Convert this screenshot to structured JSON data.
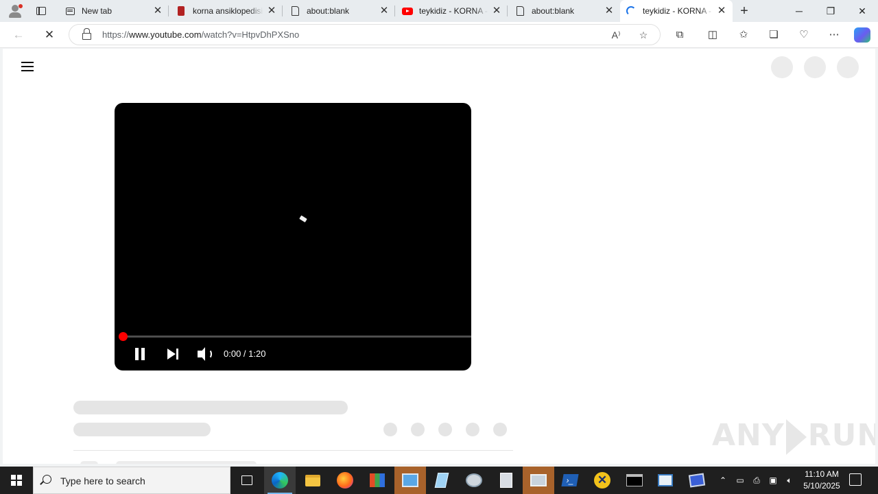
{
  "browser": {
    "tabs": [
      {
        "title": "New tab",
        "favicon": "new-tab-icon"
      },
      {
        "title": "korna ansiklopedisi",
        "favicon": "site-icon"
      },
      {
        "title": "about:blank",
        "favicon": "page-icon"
      },
      {
        "title": "teykidiz - KORNA - YouTube",
        "favicon": "youtube-icon"
      },
      {
        "title": "about:blank",
        "favicon": "page-icon"
      },
      {
        "title": "teykidiz - KORNA - YouTube",
        "favicon": "loading-icon",
        "active": true
      }
    ],
    "address": {
      "scheme": "https://",
      "host": "www.youtube.com",
      "path": "/watch?v=HtpvDhPXSno"
    }
  },
  "player": {
    "time": "0:00 / 1:20",
    "progress": 0.0,
    "state": "playing"
  },
  "watermark": {
    "left": "ANY",
    "right": "RUN"
  },
  "taskbar": {
    "search_placeholder": "Type here to search",
    "time": "11:10 AM",
    "date": "5/10/2025"
  },
  "colors": {
    "youtube_red": "#ff0000",
    "taskbar": "#1f1f1f",
    "edge_accent": "#76b9ed"
  }
}
